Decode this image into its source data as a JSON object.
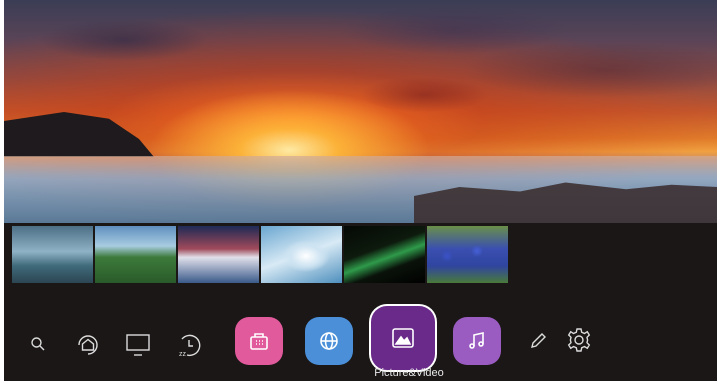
{
  "hero": {
    "icon": "sunset-photo"
  },
  "thumbnails": [
    {
      "icon": "lake-photo"
    },
    {
      "icon": "meadow-photo"
    },
    {
      "icon": "waterfall-photo"
    },
    {
      "icon": "rapids-photo"
    },
    {
      "icon": "green-leaf-photo"
    },
    {
      "icon": "bluebell-flowers-photo"
    }
  ],
  "dock": {
    "items": [
      {
        "icon": "search-icon"
      },
      {
        "icon": "home-icon"
      },
      {
        "icon": "tv-source-icon"
      },
      {
        "icon": "sleep-timer-icon"
      },
      {
        "icon": "app-store-icon",
        "color": "#e05a9c"
      },
      {
        "icon": "browser-globe-icon",
        "color": "#4a8fd8"
      },
      {
        "icon": "picture-video-icon",
        "color": "#6a2a8a",
        "focused": true
      },
      {
        "icon": "music-note-icon",
        "color": "#9a5cc0"
      },
      {
        "icon": "edit-pencil-icon"
      },
      {
        "icon": "settings-gear-icon"
      }
    ],
    "focused_label": "Picture&Video"
  }
}
